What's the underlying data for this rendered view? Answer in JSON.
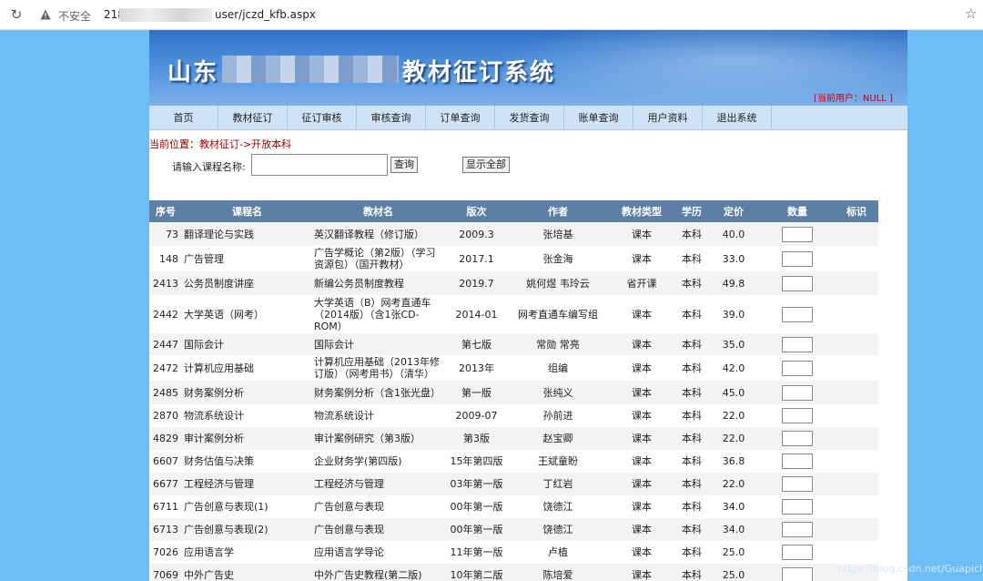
{
  "browser": {
    "insecure_label": "不安全",
    "url_prefix": "218",
    "url_path": "user/jczd_kfb.aspx"
  },
  "banner": {
    "title_prefix": "山东",
    "title_suffix": "教材征订系统",
    "current_user": "[当前用户：NULL ]"
  },
  "nav": {
    "items": [
      "首页",
      "教材征订",
      "征订审核",
      "审核查询",
      "订单查询",
      "发货查询",
      "账单查询",
      "用户资料",
      "退出系统"
    ]
  },
  "breadcrumb": "当前位置：教材征订->开放本科",
  "search": {
    "label": "请输入课程名称:",
    "value": "",
    "query_button": "查询",
    "show_all_button": "显示全部"
  },
  "table": {
    "headers": [
      "序号",
      "课程名",
      "教材名",
      "版次",
      "作者",
      "教材类型",
      "学历",
      "定价",
      "数量",
      "标识"
    ],
    "rows": [
      [
        "73",
        "翻译理论与实践",
        "英汉翻译教程（修订版）",
        "2009.3",
        "张培基",
        "课本",
        "本科",
        "40.0"
      ],
      [
        "148",
        "广告管理",
        "广告学概论（第2版）（学习资源包）（国开教材）",
        "2017.1",
        "张金海",
        "课本",
        "本科",
        "33.0"
      ],
      [
        "2413",
        "公务员制度讲座",
        "新编公务员制度教程",
        "2019.7",
        "姚何煜 韦玲云",
        "省开课",
        "本科",
        "49.8"
      ],
      [
        "2442",
        "大学英语（网考）",
        "大学英语（B）网考直通车（2014版）（含1张CD-ROM）",
        "2014-01",
        "网考直通车编写组",
        "课本",
        "本科",
        "39.0"
      ],
      [
        "2447",
        "国际会计",
        "国际会计",
        "第七版",
        "常勋 常亮",
        "课本",
        "本科",
        "35.0"
      ],
      [
        "2472",
        "计算机应用基础",
        "计算机应用基础（2013年修订版）（网考用书）（清华）",
        "2013年",
        "组编",
        "课本",
        "本科",
        "42.0"
      ],
      [
        "2485",
        "财务案例分析",
        "财务案例分析（含1张光盘）",
        "第一版",
        "张纯义",
        "课本",
        "本科",
        "45.0"
      ],
      [
        "2870",
        "物流系统设计",
        "物流系统设计",
        "2009-07",
        "孙前进",
        "课本",
        "本科",
        "22.0"
      ],
      [
        "4829",
        "审计案例分析",
        "审计案例研究（第3版）",
        "第3版",
        "赵宝卿",
        "课本",
        "本科",
        "22.0"
      ],
      [
        "6607",
        "财务估值与决策",
        "企业财务学(第四版)",
        "15年第四版",
        "王斌童盼",
        "课本",
        "本科",
        "36.8"
      ],
      [
        "6677",
        "工程经济与管理",
        "工程经济与管理",
        "03年第一版",
        "丁红岩",
        "课本",
        "本科",
        "22.0"
      ],
      [
        "6711",
        "广告创意与表现(1)",
        "广告创意与表现",
        "00年第一版",
        "饶德江",
        "课本",
        "本科",
        "34.0"
      ],
      [
        "6713",
        "广告创意与表现(2)",
        "广告创意与表现",
        "00年第一版",
        "饶德江",
        "课本",
        "本科",
        "34.0"
      ],
      [
        "7026",
        "应用语言学",
        "应用语言学导论",
        "11年第一版",
        "卢植",
        "课本",
        "本科",
        "25.0"
      ],
      [
        "7069",
        "中外广告史",
        "中外广告史教程(第二版)",
        "10年第二版",
        "陈培爱",
        "课本",
        "本科",
        "25.0"
      ]
    ]
  },
  "watermark": "https://blog.csdn.net/Guapichen"
}
